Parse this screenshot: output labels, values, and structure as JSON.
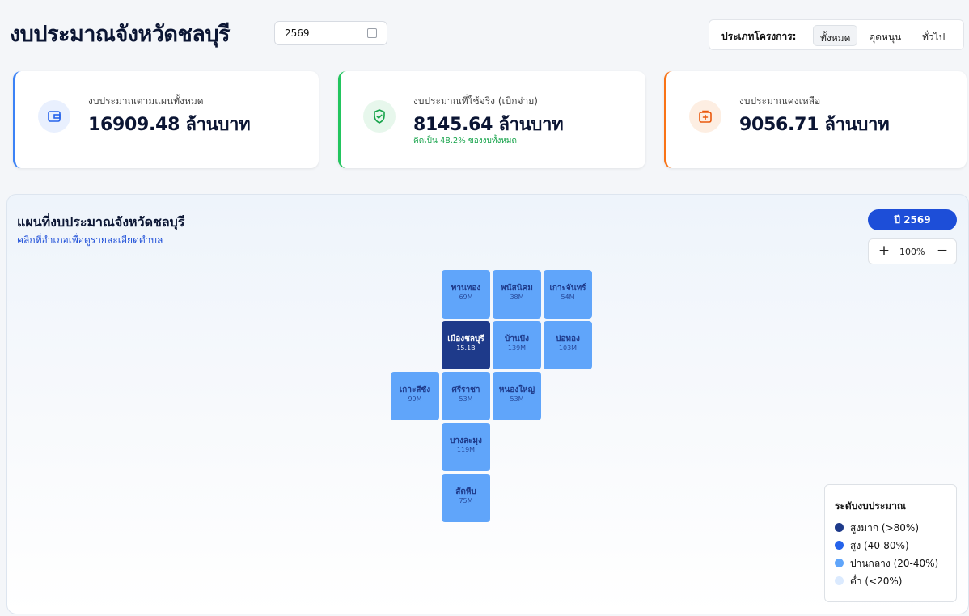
{
  "header": {
    "title": "งบประมาณจังหวัดชลบุรี",
    "year_value": "2569",
    "filter": {
      "label": "ประเภทโครงการ:",
      "options": [
        "ทั้งหมด",
        "อุดหนุน",
        "ทั่วไป"
      ],
      "selected": "ทั้งหมด"
    }
  },
  "stats": [
    {
      "label": "งบประมาณตามแผนทั้งหมด",
      "value": "16909.48 ล้านบาท",
      "icon": "wallet-icon",
      "accent": "#3b82f6"
    },
    {
      "label": "งบประมาณที่ใช้จริง (เบิกจ่าย)",
      "value": "8145.64 ล้านบาท",
      "note": "คิดเป็น 48.2% ของงบทั้งหมด",
      "icon": "shield-check-icon",
      "accent": "#22c55e"
    },
    {
      "label": "งบประมาณคงเหลือ",
      "value": "9056.71 ล้านบาท",
      "icon": "medical-box-icon",
      "accent": "#f97316"
    }
  ],
  "map": {
    "title": "แผนที่งบประมาณจังหวัดชลบุรี",
    "subtitle": "คลิกที่อำเภอเพื่อดูรายละเอียดตำบล",
    "year_badge": "ปี 2569",
    "zoom_level": "100%",
    "zoom_in": "+",
    "zoom_out": "−",
    "districts": [
      {
        "name": "พานทอง",
        "value": "69M",
        "level": "medium"
      },
      {
        "name": "พนัสนิคม",
        "value": "38M",
        "level": "medium"
      },
      {
        "name": "เกาะจันทร์",
        "value": "54M",
        "level": "medium"
      },
      {
        "name": "เมืองชลบุรี",
        "value": "15.1B",
        "level": "very-high"
      },
      {
        "name": "บ้านบึง",
        "value": "139M",
        "level": "medium"
      },
      {
        "name": "บ่อทอง",
        "value": "103M",
        "level": "medium"
      },
      {
        "name": "เกาะสีชัง",
        "value": "99M",
        "level": "medium"
      },
      {
        "name": "ศรีราชา",
        "value": "53M",
        "level": "medium"
      },
      {
        "name": "หนองใหญ่",
        "value": "53M",
        "level": "medium"
      },
      {
        "name": "บางละมุง",
        "value": "119M",
        "level": "medium"
      },
      {
        "name": "สัตหีบ",
        "value": "75M",
        "level": "medium"
      }
    ],
    "legend": {
      "title": "ระดับงบประมาณ",
      "items": [
        {
          "label": "สูงมาก (>80%)",
          "color": "#1e3a8a"
        },
        {
          "label": "สูง (40-80%)",
          "color": "#2563eb"
        },
        {
          "label": "ปานกลาง (20-40%)",
          "color": "#60a5fa"
        },
        {
          "label": "ต่ำ (<20%)",
          "color": "#dbeafe"
        }
      ]
    }
  }
}
